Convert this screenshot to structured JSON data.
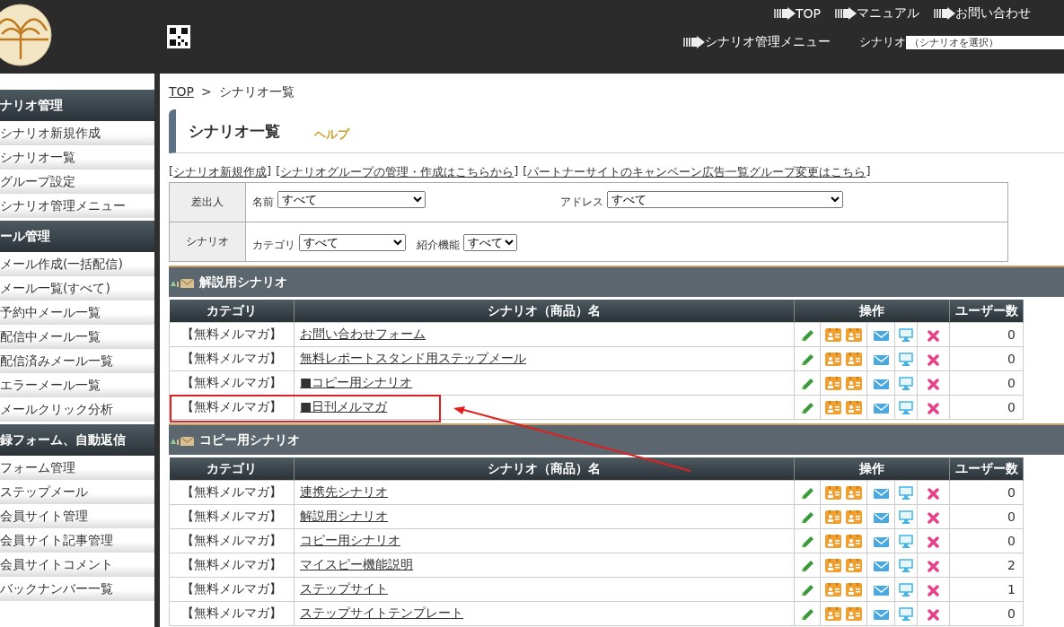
{
  "header": {
    "nav_links": [
      "TOP",
      "マニュアル",
      "お問い合わせ"
    ],
    "menu_link": "シナリオ管理メニュー",
    "scenario_label": "シナリオ",
    "scenario_select": "（シナリオを選択）"
  },
  "sidebar": {
    "sections": [
      {
        "title": "ナリオ管理",
        "items": [
          "シナリオ新規作成",
          "シナリオ一覧",
          "グループ設定",
          "シナリオ管理メニュー"
        ]
      },
      {
        "title": "ール管理",
        "items": [
          "メール作成(一括配信)",
          "メール一覧(すべて)",
          "予約中メール一覧",
          "配信中メール一覧",
          "配信済みメール一覧",
          "エラーメール一覧",
          "メールクリック分析"
        ]
      },
      {
        "title": "録フォーム、自動返信",
        "items": [
          "フォーム管理",
          "ステップメール",
          "会員サイト管理",
          "会員サイト記事管理",
          "会員サイトコメント",
          "バックナンバー一覧"
        ]
      }
    ]
  },
  "breadcrumb": {
    "link": "TOP",
    "separator": ">",
    "current": "シナリオ一覧"
  },
  "page_title": "シナリオ一覧",
  "help_link": "ヘルプ",
  "action_links": {
    "open": "[",
    "close": "]",
    "links": [
      "シナリオ新規作成",
      "シナリオグループの管理・作成はこちらから",
      "パートナーサイトのキャンペーン広告一覧グループ変更はこちら"
    ]
  },
  "filters": [
    {
      "label": "差出人",
      "fields": [
        {
          "label": "名前",
          "value": "すべて"
        },
        {
          "label": "アドレス",
          "value": "すべて"
        }
      ]
    },
    {
      "label": "シナリオ",
      "fields": [
        {
          "label": "カテゴリ",
          "value": "すべて"
        },
        {
          "label": "紹介機能",
          "value": "すべて"
        }
      ]
    }
  ],
  "sections": [
    {
      "title": "解説用シナリオ",
      "columns": [
        "カテゴリ",
        "シナリオ（商品）名",
        "操作",
        "ユーザー数"
      ],
      "rows": [
        {
          "category": "【無料メルマガ】",
          "name": "お問い合わせフォーム",
          "users": "0",
          "highlighted": false
        },
        {
          "category": "【無料メルマガ】",
          "name": "無料レポートスタンド用ステップメール",
          "users": "0",
          "highlighted": false
        },
        {
          "category": "【無料メルマガ】",
          "name": "■コピー用シナリオ",
          "users": "0",
          "highlighted": false
        },
        {
          "category": "【無料メルマガ】",
          "name": "■日刊メルマガ",
          "users": "0",
          "highlighted": true
        }
      ]
    },
    {
      "title": "コピー用シナリオ",
      "columns": [
        "カテゴリ",
        "シナリオ（商品）名",
        "操作",
        "ユーザー数"
      ],
      "rows": [
        {
          "category": "【無料メルマガ】",
          "name": "連携先シナリオ",
          "users": "0",
          "highlighted": false
        },
        {
          "category": "【無料メルマガ】",
          "name": "解説用シナリオ",
          "users": "0",
          "highlighted": false
        },
        {
          "category": "【無料メルマガ】",
          "name": "コピー用シナリオ",
          "users": "0",
          "highlighted": false
        },
        {
          "category": "【無料メルマガ】",
          "name": "マイスピー機能説明",
          "users": "2",
          "highlighted": false
        },
        {
          "category": "【無料メルマガ】",
          "name": "ステップサイト",
          "users": "1",
          "highlighted": false
        },
        {
          "category": "【無料メルマガ】",
          "name": "ステップサイトテンプレート",
          "users": "0",
          "highlighted": false
        }
      ]
    }
  ]
}
